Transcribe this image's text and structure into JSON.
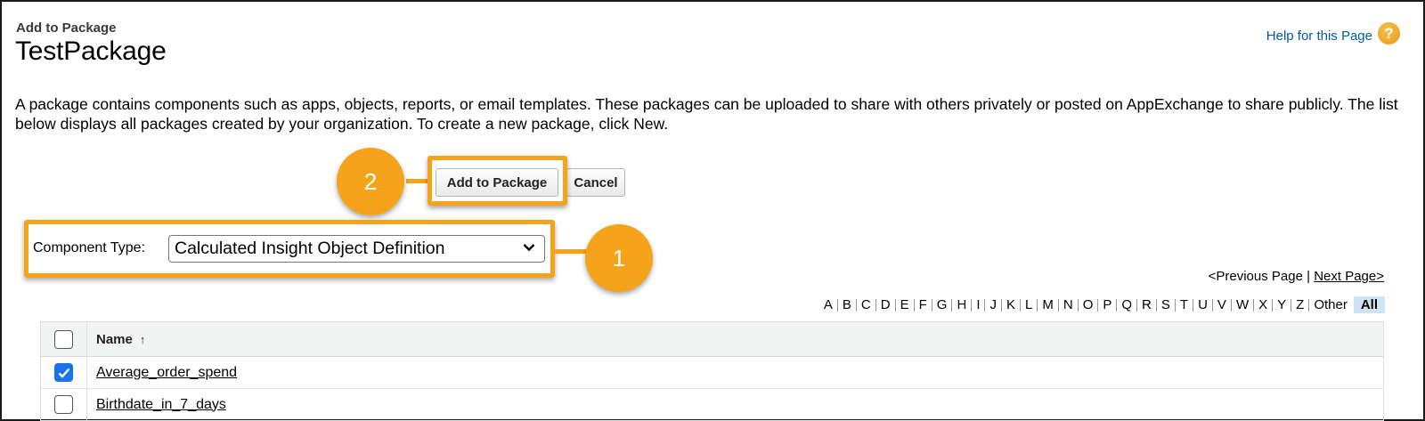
{
  "header": {
    "breadcrumb": "Add to Package",
    "title": "TestPackage",
    "help_link": "Help for this Page",
    "help_icon_glyph": "?"
  },
  "description": "A package contains components such as apps, objects, reports, or email templates. These packages can be uploaded to share with others privately or posted on AppExchange to share publicly. The list below displays all packages created by your organization. To create a new package, click New.",
  "actions": {
    "add_label": "Add to Package",
    "cancel_label": "Cancel"
  },
  "callouts": {
    "step_1": "1",
    "step_2": "2",
    "color": "#f5a31a"
  },
  "filter": {
    "label": "Component Type:",
    "selected": "Calculated Insight Object Definition"
  },
  "pager": {
    "previous": "<Previous Page",
    "separator": "|",
    "next": "Next Page>"
  },
  "alphabet": [
    "A",
    "B",
    "C",
    "D",
    "E",
    "F",
    "G",
    "H",
    "I",
    "J",
    "K",
    "L",
    "M",
    "N",
    "O",
    "P",
    "Q",
    "R",
    "S",
    "T",
    "U",
    "V",
    "W",
    "X",
    "Y",
    "Z",
    "Other"
  ],
  "alphabet_all": "All",
  "table": {
    "columns": [
      "Name"
    ],
    "sort_glyph": "↑",
    "rows": [
      {
        "name": "Average_order_spend",
        "checked": true
      },
      {
        "name": "Birthdate_in_7_days",
        "checked": false
      }
    ]
  },
  "colors": {
    "link": "#015ba7",
    "accent_orange": "#f5a31a",
    "checkbox_checked": "#1a73e8",
    "all_highlight": "#cfe3f7"
  }
}
